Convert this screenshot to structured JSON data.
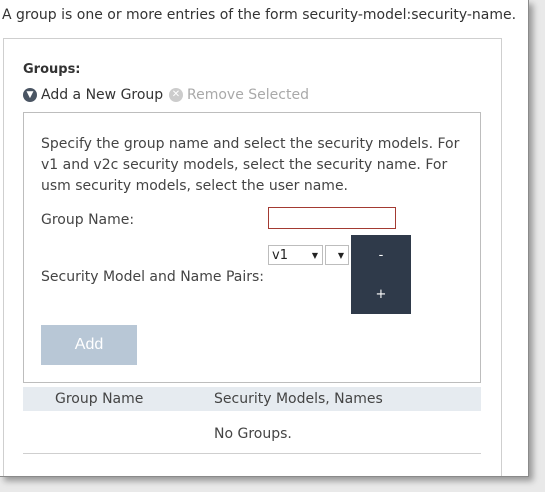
{
  "intro_text": "A group is one or more entries of the form security-model:security-name.",
  "groups": {
    "label": "Groups:",
    "add_action": "Add a New Group",
    "remove_action": "Remove Selected"
  },
  "form": {
    "description": "Specify the group name and select the security models. For v1 and v2c security models, select the security name. For usm security models, select the user name.",
    "group_name_label": "Group Name:",
    "group_name_value": "",
    "pairs_label": "Security Model and Name Pairs:",
    "model_select_value": "v1",
    "name_select_value": "",
    "remove_pair_label": "-",
    "add_pair_label": "+",
    "add_button_label": "Add"
  },
  "table": {
    "columns": [
      "Group Name",
      "Security Models, Names"
    ],
    "empty_text": "No Groups."
  },
  "colors": {
    "accent_dark": "#2f3a4a",
    "add_button_disabled": "#b8c7d6",
    "input_border_error": "#a33a32",
    "header_bg": "#e6ebf0"
  },
  "icons": {
    "add_group": "chevron-down-circle-icon",
    "remove_selected": "x-circle-icon"
  }
}
